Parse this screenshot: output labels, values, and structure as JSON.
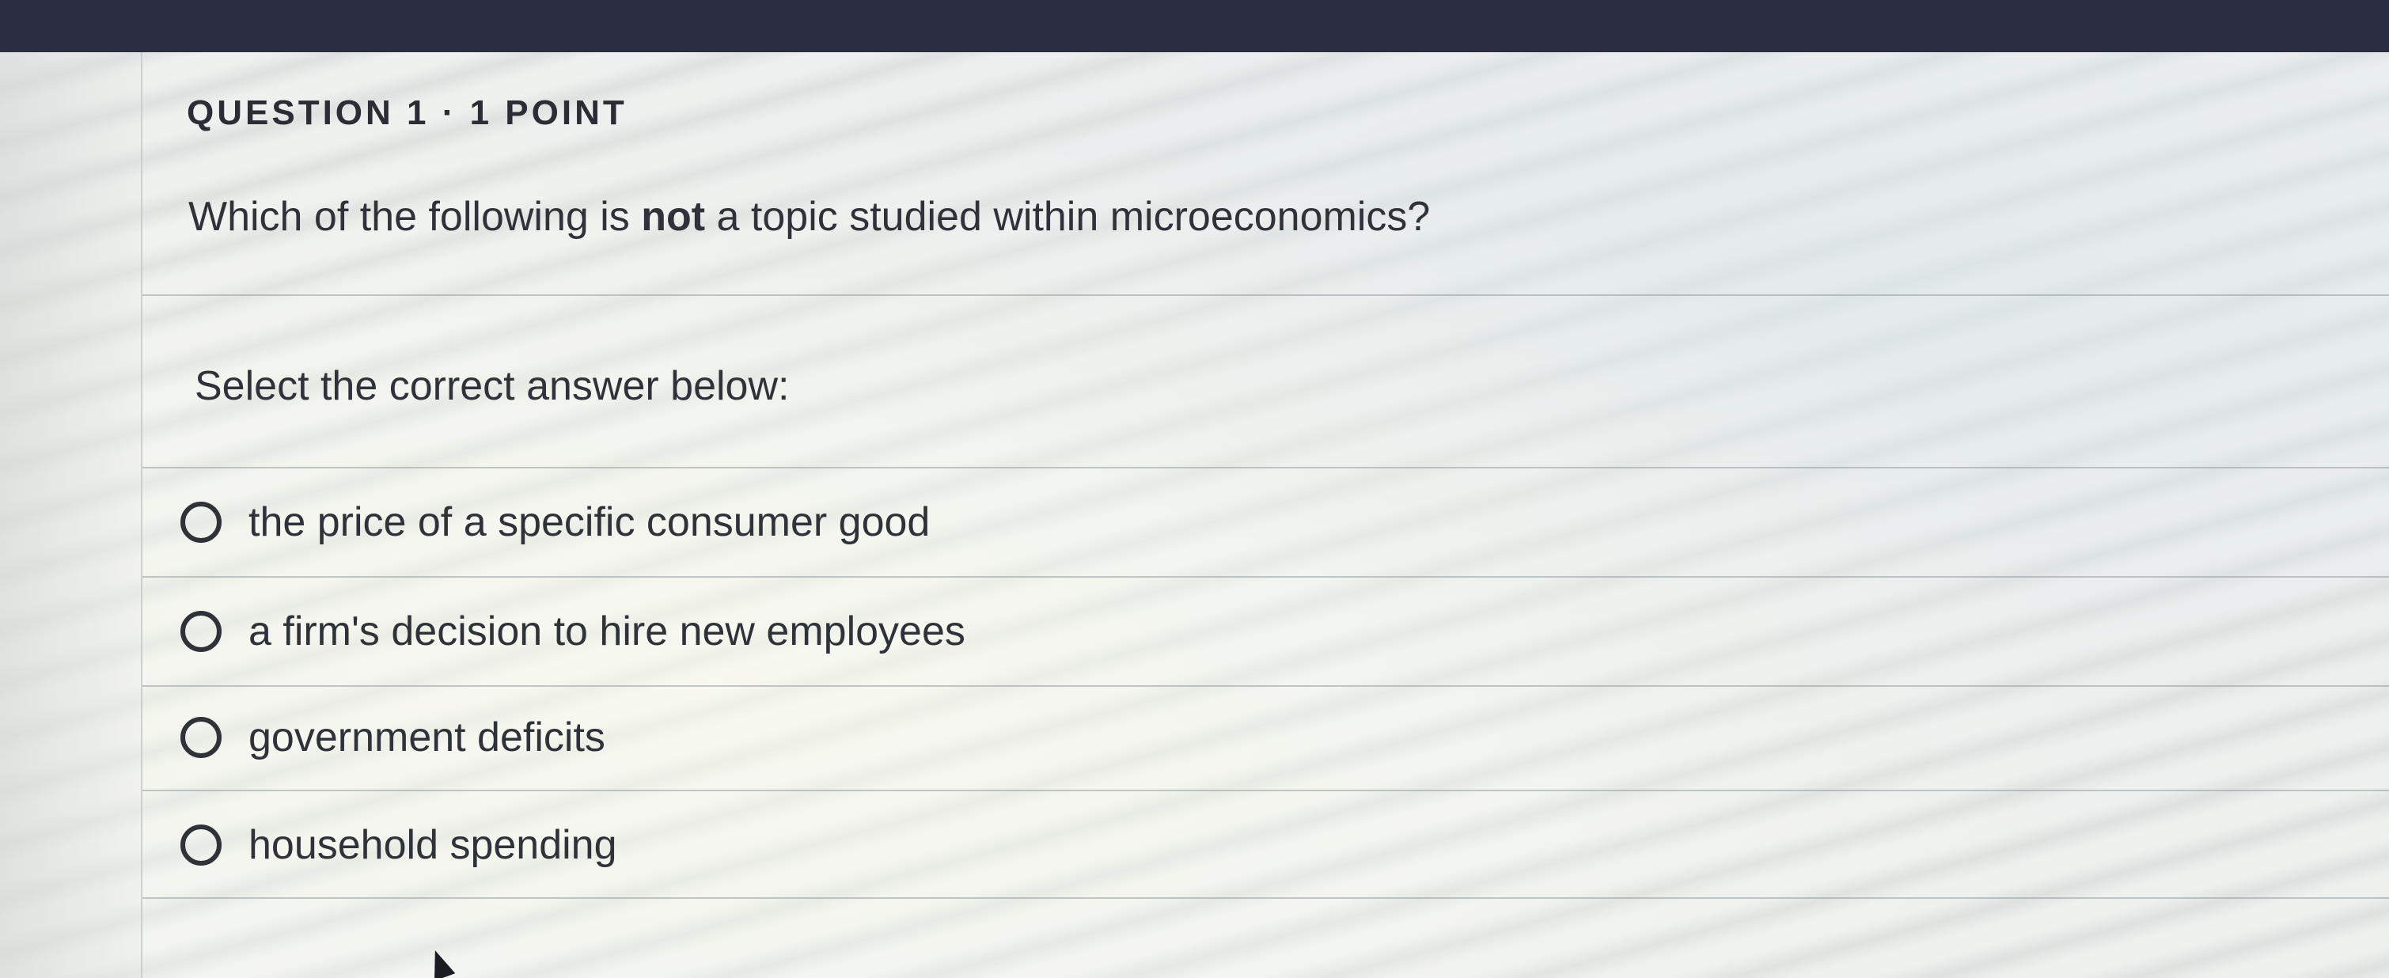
{
  "question": {
    "header": "QUESTION 1 · 1 POINT",
    "text_before": "Which of the following is ",
    "text_emphasis": "not",
    "text_after": " a topic studied within microeconomics?",
    "instruction": "Select the correct answer below:"
  },
  "options": [
    {
      "label": "the price of a specific consumer good",
      "selected": false
    },
    {
      "label": "a firm's decision to hire new employees",
      "selected": false
    },
    {
      "label": "government deficits",
      "selected": false
    },
    {
      "label": "household spending",
      "selected": false
    }
  ],
  "colors": {
    "top_bar": "#2a2e40",
    "text": "#2f3238"
  },
  "icons": {
    "radio": "radio-button-empty-icon",
    "cursor": "mouse-pointer-icon"
  }
}
